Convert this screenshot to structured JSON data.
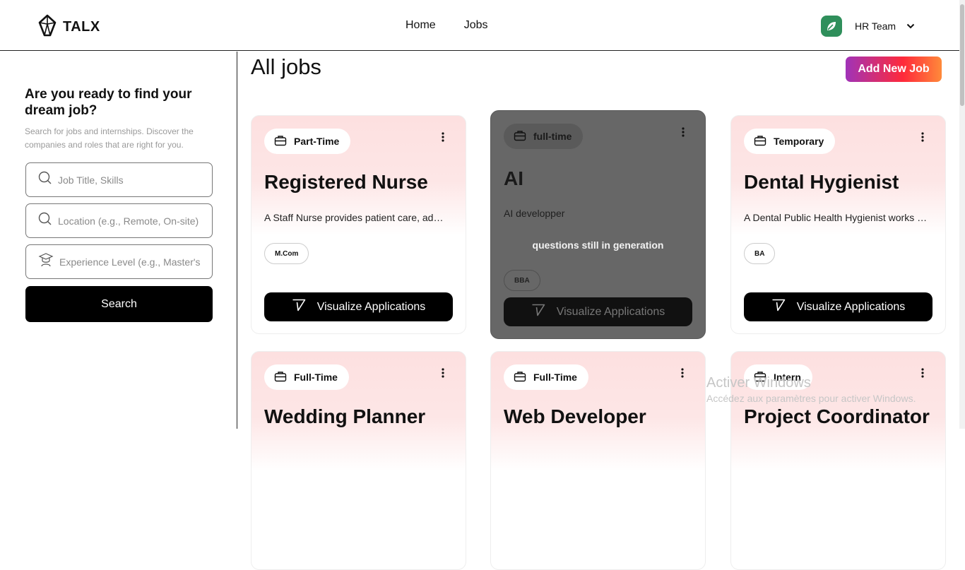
{
  "header": {
    "logo_text": "TALX",
    "nav": [
      "Home",
      "Jobs"
    ],
    "user_name": "HR Team",
    "avatar_color": "#2f8f5b"
  },
  "sidebar": {
    "title": "Are you ready to find your dream job?",
    "description": "Search for jobs and internships. Discover the companies and roles that are right for you.",
    "fields": [
      {
        "placeholder": "Job Title, Skills",
        "icon": "search-icon"
      },
      {
        "placeholder": "Location (e.g., Remote, On-site)",
        "icon": "search-icon"
      },
      {
        "placeholder": "Experience Level (e.g., Master's,",
        "icon": "graduate-icon"
      }
    ],
    "search_label": "Search"
  },
  "main": {
    "title": "All jobs",
    "add_button": "Add New Job",
    "viz_label": "Visualize Applications",
    "cards": [
      {
        "type": "Part-Time",
        "title": "Registered Nurse",
        "desc": "A Staff Nurse provides patient care, administers medications",
        "chip": "M.Com"
      },
      {
        "type": "full-time",
        "title": "AI",
        "desc": "AI developper",
        "chip": "BBA",
        "note": "questions still in generation",
        "disabled": true
      },
      {
        "type": "Temporary",
        "title": "Dental Hygienist",
        "desc": "A Dental Public Health Hygienist works to promote oral health",
        "chip": "BA"
      },
      {
        "type": "Full-Time",
        "title": "Wedding Planner"
      },
      {
        "type": "Full-Time",
        "title": "Web Developer"
      },
      {
        "type": "Intern",
        "title": "Project Coordinator"
      }
    ]
  },
  "watermark": {
    "line1": "Activer Windows",
    "line2": "Accédez aux paramètres pour activer Windows."
  }
}
